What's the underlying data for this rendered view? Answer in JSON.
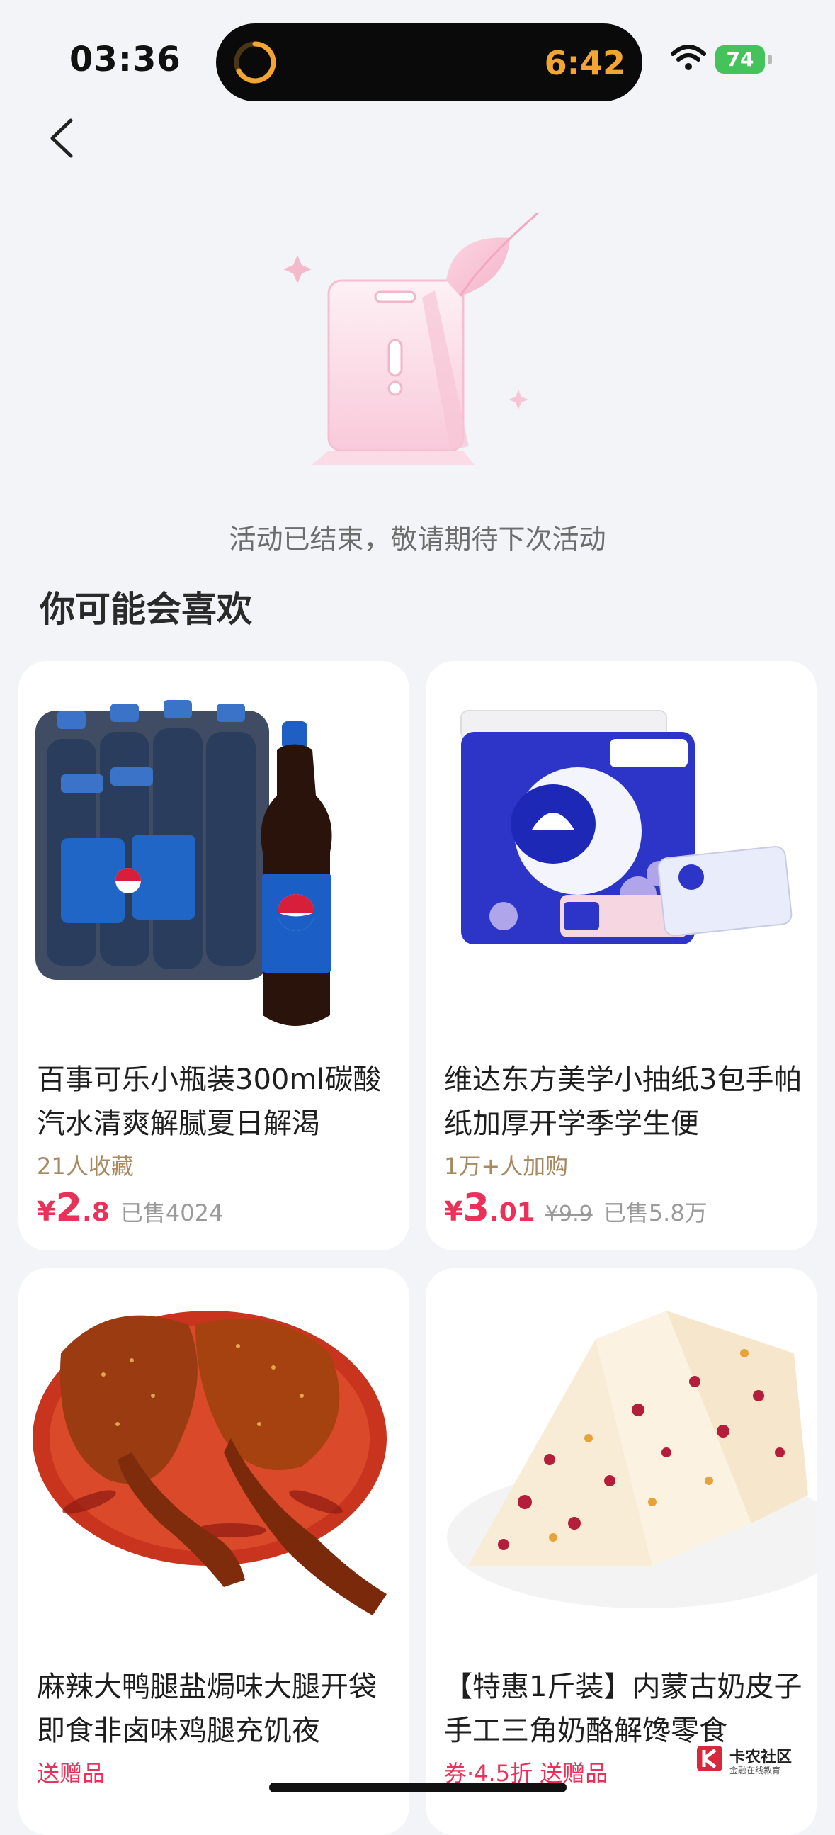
{
  "status_bar": {
    "time": "03:36",
    "island_time": "6:42",
    "battery": "74"
  },
  "empty_state": {
    "message": "活动已结束，敬请期待下次活动"
  },
  "recommend": {
    "title": "你可能会喜欢",
    "products": [
      {
        "title": "百事可乐小瓶装300ml碳酸汽水清爽解腻夏日解渴",
        "tag": "21人收藏",
        "price_currency": "¥",
        "price_int": "2",
        "price_dec": ".8",
        "original_price": "",
        "sold": "已售4024"
      },
      {
        "title": "维达东方美学小抽纸3包手帕纸加厚开学季学生便",
        "tag": "1万+人加购",
        "price_currency": "¥",
        "price_int": "3",
        "price_dec": ".01",
        "original_price": "¥9.9",
        "sold": "已售5.8万"
      },
      {
        "title": "麻辣大鸭腿盐焗味大腿开袋即食非卤味鸡腿充饥夜",
        "tag": "送赠品"
      },
      {
        "title": "【特惠1斤装】内蒙古奶皮子手工三角奶酪解馋零食",
        "tag": "券·4.5折  送赠品"
      }
    ]
  },
  "watermark": {
    "label": "卡农社区",
    "sub": "金融在线教育"
  },
  "colors": {
    "accent": "#e8325a",
    "background": "#f3f4f8",
    "tag": "#a88a62"
  }
}
